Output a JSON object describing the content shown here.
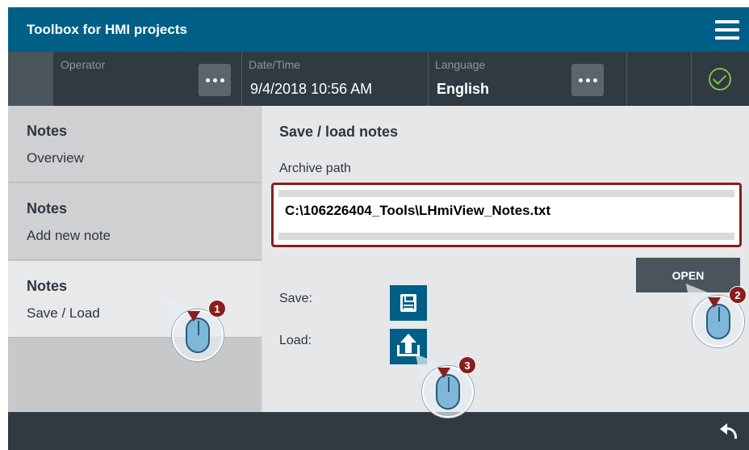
{
  "header": {
    "title": "Toolbox for HMI projects",
    "menu_icon": "hamburger-menu-icon"
  },
  "status": {
    "operator_label": "Operator",
    "operator_value": "",
    "datetime_label": "Date/Time",
    "datetime_value": "9/4/2018 10:56 AM",
    "language_label": "Language",
    "language_value": "English",
    "status_icon": "check-circle-icon",
    "status_color": "#7ac143"
  },
  "sidebar": {
    "items": [
      {
        "title": "Notes",
        "subtitle": "Overview",
        "active": false
      },
      {
        "title": "Notes",
        "subtitle": "Add new note",
        "active": false
      },
      {
        "title": "Notes",
        "subtitle": "Save / Load",
        "active": true
      }
    ]
  },
  "main": {
    "heading": "Save / load notes",
    "path_label": "Archive path",
    "path_value": "C:\\106226404_Tools\\LHmiView_Notes.txt",
    "open_label": "OPEN",
    "save_label": "Save:",
    "load_label": "Load:",
    "save_icon": "floppy-disk-icon",
    "load_icon": "upload-icon"
  },
  "footer": {
    "back_icon": "back-arrow-icon"
  },
  "annotations": [
    {
      "number": "1"
    },
    {
      "number": "2"
    },
    {
      "number": "3"
    }
  ],
  "colors": {
    "header_bg": "#005f87",
    "status_bg": "#2f3a42",
    "highlight_frame": "#8a1d1d",
    "button_bg": "#4a545c",
    "icon_button_bg": "#005f87"
  }
}
